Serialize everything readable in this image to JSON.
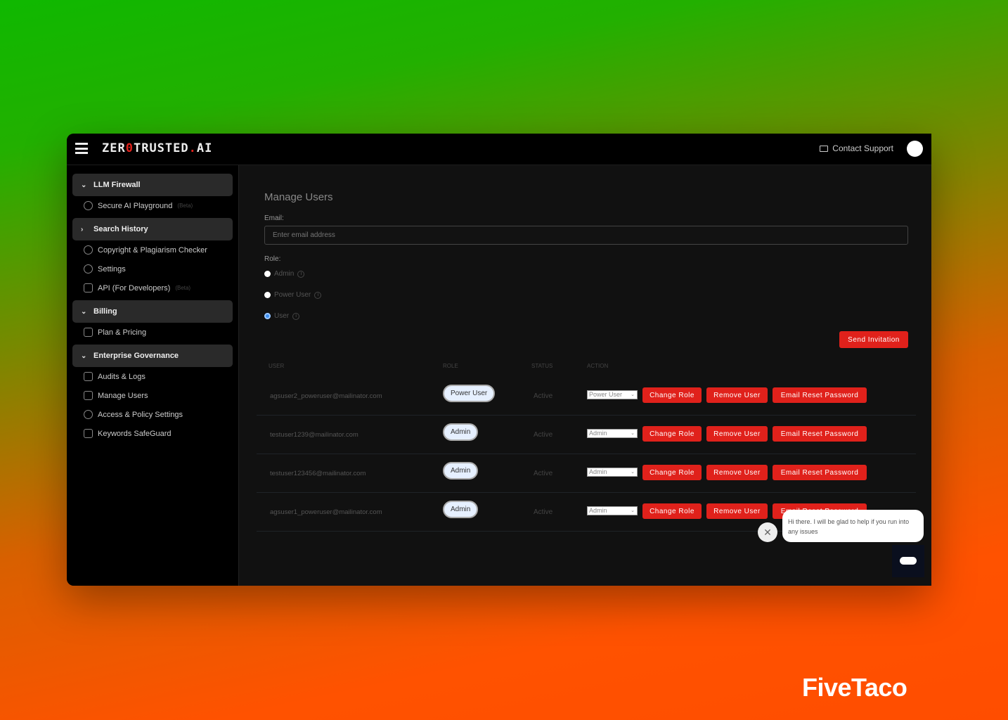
{
  "header": {
    "logo_pre": "ZER",
    "logo_zero": "0",
    "logo_mid": "TRUSTED",
    "logo_dot": ".",
    "logo_post": "AI",
    "contact_support": "Contact Support"
  },
  "sidebar": {
    "groups": [
      {
        "label": "LLM Firewall",
        "items": [
          {
            "label": "Secure AI Playground",
            "badge": "(Beta)",
            "icon": "chat-bubble-icon"
          }
        ]
      },
      {
        "label": "Search History",
        "items": [
          {
            "label": "Copyright & Plagiarism Checker",
            "icon": "check-circle-icon"
          },
          {
            "label": "Settings",
            "icon": "gear-icon"
          },
          {
            "label": "API (For Developers)",
            "badge": "(Beta)",
            "icon": "document-icon"
          }
        ]
      },
      {
        "label": "Billing",
        "items": [
          {
            "label": "Plan & Pricing",
            "icon": "credit-card-icon"
          }
        ]
      },
      {
        "label": "Enterprise Governance",
        "items": [
          {
            "label": "Audits & Logs",
            "icon": "document-icon"
          },
          {
            "label": "Manage Users",
            "icon": "user-square-icon"
          },
          {
            "label": "Access & Policy Settings",
            "icon": "gear-icon"
          },
          {
            "label": "Keywords SafeGuard",
            "icon": "users-icon"
          }
        ]
      }
    ]
  },
  "main": {
    "title": "Manage Users",
    "email_label": "Email:",
    "email_placeholder": "Enter email address",
    "email_value": "",
    "role_label": "Role:",
    "roles": [
      "Admin",
      "Power User",
      "User"
    ],
    "selected_role": "User",
    "send_invitation": "Send Invitation",
    "columns": [
      "USER",
      "ROLE",
      "STATUS",
      "ACTION"
    ],
    "users": [
      {
        "email": "agsuser2_poweruser@mailinator.com",
        "role": "Power User",
        "status": "Active",
        "select": "Power User"
      },
      {
        "email": "testuser1239@mailinator.com",
        "role": "Admin",
        "status": "Active",
        "select": "Admin"
      },
      {
        "email": "testuser123456@mailinator.com",
        "role": "Admin",
        "status": "Active",
        "select": "Admin"
      },
      {
        "email": "agsuser1_poweruser@mailinator.com",
        "role": "Admin",
        "status": "Active",
        "select": "Admin"
      }
    ],
    "actions": {
      "change_role": "Change Role",
      "remove_user": "Remove User",
      "email_reset": "Email Reset Password"
    }
  },
  "chat": {
    "message": "Hi there. I will be glad to help if you run into any issues"
  },
  "watermark": "FiveTaco",
  "colors": {
    "accent": "#e0211b",
    "radio_selected": "#3b8df0"
  }
}
